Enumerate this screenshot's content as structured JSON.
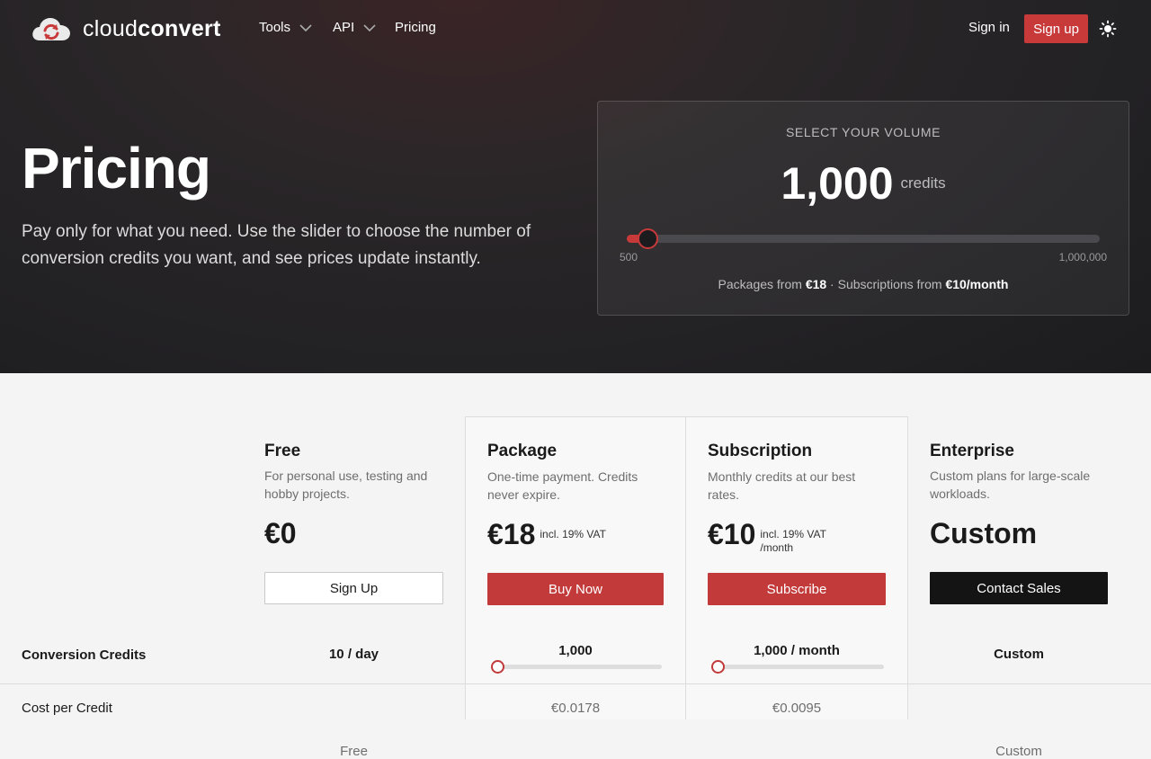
{
  "nav": {
    "logo_light": "cloud",
    "logo_bold": "convert",
    "tools_label": "Tools",
    "api_label": "API",
    "pricing_label": "Pricing",
    "signin_label": "Sign in",
    "signup_label": "Sign up"
  },
  "hero": {
    "title": "Pricing",
    "description": "Pay only for what you need. Use the slider to choose the number of conversion credits you want, and see prices update instantly."
  },
  "volume": {
    "label": "SELECT YOUR VOLUME",
    "amount": "1,000",
    "unit": "credits",
    "slider_min": "500",
    "slider_max": "1,000,000",
    "slider_position": 0.0005,
    "summary_prefix": "Packages from ",
    "summary_package": "€18",
    "summary_middle": " · Subscriptions from ",
    "summary_subscription": "€10/month"
  },
  "plans": {
    "free": {
      "name": "Free",
      "description": "For personal use, testing and hobby projects.",
      "price": "€0",
      "button": "Sign Up",
      "credits": "10 / day",
      "cost_per_credit": "Free"
    },
    "package": {
      "name": "Package",
      "description": "One-time payment. Credits never expire.",
      "price": "€18",
      "vat": "incl. 19% VAT",
      "button": "Buy Now",
      "credits": "1,000",
      "cost_per_credit": "€0.0178"
    },
    "subscription": {
      "name": "Subscription",
      "description": "Monthly credits at our best rates.",
      "price": "€10",
      "vat": "incl. 19% VAT",
      "period": "/month",
      "button": "Subscribe",
      "credits": "1,000 / month",
      "cost_per_credit": "€0.0095"
    },
    "enterprise": {
      "name": "Enterprise",
      "description": "Custom plans for large-scale workloads.",
      "price": "Custom",
      "button": "Contact Sales",
      "credits": "Custom",
      "cost_per_credit": "Custom"
    }
  },
  "rows": {
    "credits_label": "Conversion Credits",
    "cost_label": "Cost per Credit"
  },
  "colors": {
    "accent": "#c8393a",
    "hero_bg": "#222124",
    "black_button": "#141414"
  },
  "icons": {
    "logo": "cloud-convert-logo",
    "chevron": "chevron-down-icon",
    "theme": "sun-icon"
  }
}
